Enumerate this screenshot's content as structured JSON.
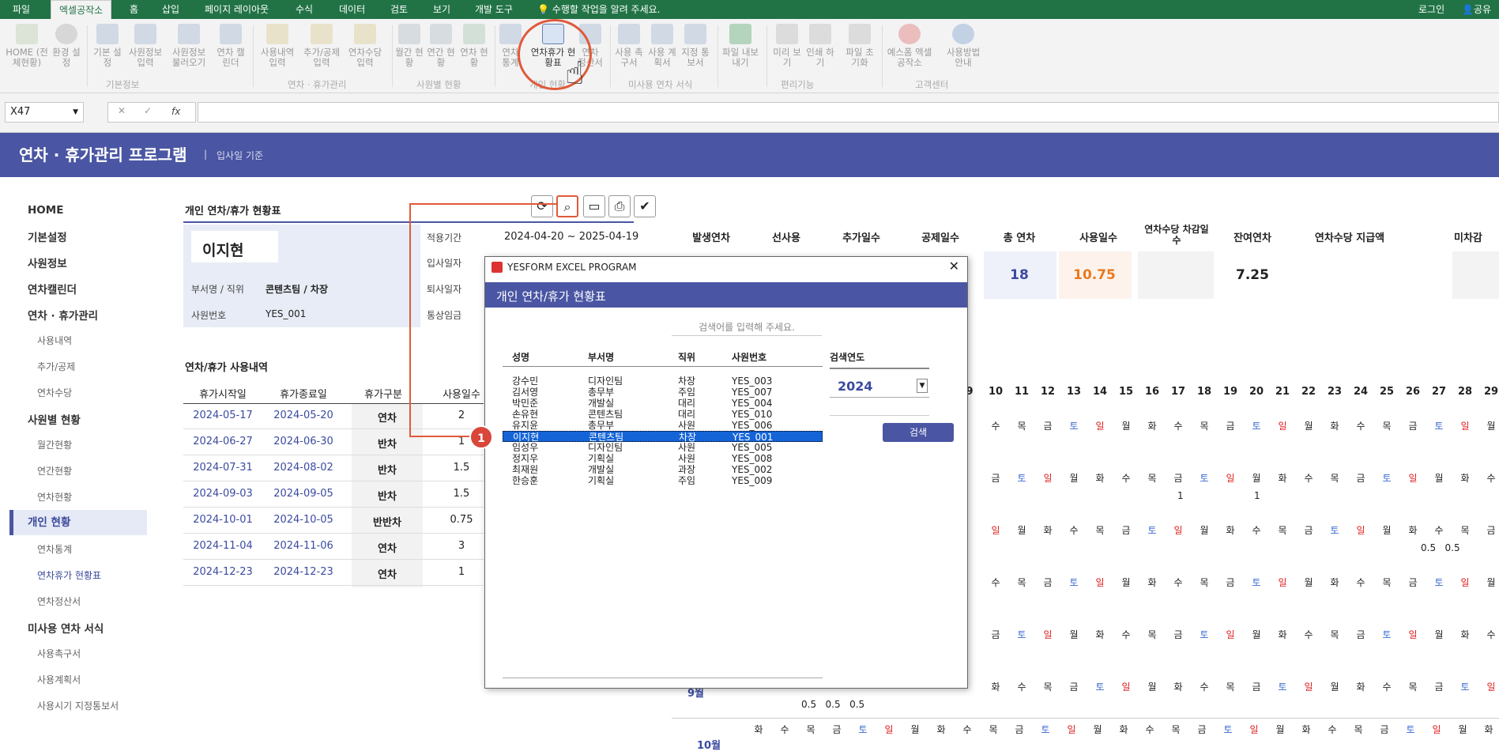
{
  "tabs": [
    "파일",
    "엑셀공작소",
    "홈",
    "삽입",
    "페이지 레이아웃",
    "수식",
    "데이터",
    "검토",
    "보기",
    "개발 도구"
  ],
  "tell_me": "수행할 작업을 알려 주세요.",
  "login": "로그인",
  "share": "공유",
  "ribbon": {
    "buttons": [
      "HOME (전체현황)",
      "환경 설정",
      "기본 설정",
      "사원정보 입력",
      "사원정보 불러오기",
      "연차 캘린더",
      "사용내역 입력",
      "추가/공제 입력",
      "연차수당 입력",
      "월간 현황",
      "연간 현황",
      "연차 현황",
      "연차 통계",
      "연차휴가 현황표",
      "연차 정산서",
      "사용 촉구서",
      "사용 계획서",
      "지정 통보서",
      "파일 내보내기",
      "미리 보기",
      "인쇄 하기",
      "파일 초기화",
      "예스폼 엑셀공작소",
      "사용방법 안내"
    ],
    "groups": [
      "기본정보",
      "연차 · 휴가관리",
      "사원별 현황",
      "개인 현황",
      "미사용 연차 서식",
      "편리기능",
      "고객센터"
    ]
  },
  "formula": {
    "name_box": "X47",
    "fx": "fx"
  },
  "header": {
    "title": "연차 · 휴가관리 프로그램",
    "subtitle": "입사일 기준"
  },
  "sidebar": [
    "HOME",
    "기본설정",
    "사원정보",
    "연차캘린더",
    "연차 · 휴가관리",
    "사용내역",
    "추가/공제",
    "연차수당",
    "사원별 현황",
    "월간현황",
    "연간현황",
    "연차현황",
    "개인 현황",
    "연차통계",
    "연차휴가 현황표",
    "연차정산서",
    "미사용 연차 서식",
    "사용촉구서",
    "사용계획서",
    "사용시기 지정통보서"
  ],
  "main": {
    "section_title": "개인 연차/휴가 현황표",
    "employee_name": "이지현",
    "dept_label": "부서명 / 직위",
    "dept_value": "콘텐츠팀 / 차장",
    "id_label": "사원번호",
    "id_value": "YES_001",
    "period_label": "적용기간",
    "period_value": "2024-04-20 ~ 2025-04-19",
    "hire_label": "입사일자",
    "leave_label": "퇴사일자",
    "wage_label": "통상임금",
    "summary_headers": [
      "발생연차",
      "선사용",
      "추가일수",
      "공제일수",
      "총 연차",
      "사용일수",
      "연차수당 차감일수",
      "잔여연차",
      "연차수당 지급액",
      "미차감"
    ],
    "summary_values": {
      "total": "18",
      "used": "10.75",
      "remain": "7.25"
    },
    "usage_title": "연차/휴가 사용내역",
    "usage_headers": [
      "휴가시작일",
      "휴가종료일",
      "휴가구분",
      "사용일수"
    ],
    "usage_rows": [
      [
        "2024-05-17",
        "2024-05-20",
        "연차",
        "2"
      ],
      [
        "2024-06-27",
        "2024-06-30",
        "반차",
        "1"
      ],
      [
        "2024-07-31",
        "2024-08-02",
        "반차",
        "1.5"
      ],
      [
        "2024-09-03",
        "2024-09-05",
        "반차",
        "1.5"
      ],
      [
        "2024-10-01",
        "2024-10-05",
        "반반차",
        "0.75"
      ],
      [
        "2024-11-04",
        "2024-11-06",
        "연차",
        "3"
      ],
      [
        "2024-12-23",
        "2024-12-23",
        "연차",
        "1"
      ]
    ],
    "cal_days": [
      "9",
      "10",
      "11",
      "12",
      "13",
      "14",
      "15",
      "16",
      "17",
      "18",
      "19",
      "20",
      "21",
      "22",
      "23",
      "24",
      "25",
      "26",
      "27",
      "28",
      "29"
    ],
    "month_labels": [
      "9월",
      "10월"
    ]
  },
  "dialog": {
    "app_title": "YESFORM EXCEL PROGRAM",
    "title": "개인 연차/휴가 현황표",
    "search_placeholder": "검색어를 입력해 주세요.",
    "col_headers": [
      "성명",
      "부서명",
      "직위",
      "사원번호"
    ],
    "rows": [
      [
        "강수민",
        "디자인팀",
        "차장",
        "YES_003"
      ],
      [
        "김서영",
        "총무부",
        "주임",
        "YES_007"
      ],
      [
        "박민준",
        "개발실",
        "대리",
        "YES_004"
      ],
      [
        "손유현",
        "콘텐츠팀",
        "대리",
        "YES_010"
      ],
      [
        "유지윤",
        "총무부",
        "사원",
        "YES_006"
      ],
      [
        "이지현",
        "콘텐츠팀",
        "차장",
        "YES_001"
      ],
      [
        "임성우",
        "디자인팀",
        "사원",
        "YES_005"
      ],
      [
        "정지우",
        "기획실",
        "사원",
        "YES_008"
      ],
      [
        "최재원",
        "개발실",
        "과장",
        "YES_002"
      ],
      [
        "한승훈",
        "기획실",
        "주임",
        "YES_009"
      ]
    ],
    "year_label": "검색연도",
    "year_value": "2024",
    "search_button": "검색"
  },
  "callout": "1"
}
